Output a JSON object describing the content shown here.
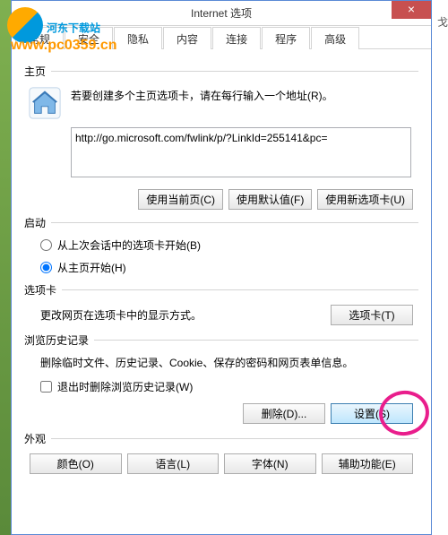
{
  "watermark": {
    "text1": "河东下载站",
    "text2": "www.pc0359.cn"
  },
  "titlebar": {
    "title": "Internet 选项",
    "close": "×"
  },
  "tabs": [
    {
      "label": "常规",
      "active": true
    },
    {
      "label": "安全",
      "active": false
    },
    {
      "label": "隐私",
      "active": false
    },
    {
      "label": "内容",
      "active": false
    },
    {
      "label": "连接",
      "active": false
    },
    {
      "label": "程序",
      "active": false
    },
    {
      "label": "高级",
      "active": false
    }
  ],
  "homepage": {
    "section_label": "主页",
    "instruction": "若要创建多个主页选项卡，请在每行输入一个地址(R)。",
    "url": "http://go.microsoft.com/fwlink/p/?LinkId=255141&pc=",
    "btn_current": "使用当前页(C)",
    "btn_default": "使用默认值(F)",
    "btn_newtab": "使用新选项卡(U)"
  },
  "startup": {
    "section_label": "启动",
    "option1": "从上次会话中的选项卡开始(B)",
    "option2": "从主页开始(H)"
  },
  "options_section": {
    "section_label": "选项卡",
    "text": "更改网页在选项卡中的显示方式。",
    "btn": "选项卡(T)"
  },
  "history": {
    "section_label": "浏览历史记录",
    "text": "删除临时文件、历史记录、Cookie、保存的密码和网页表单信息。",
    "checkbox": "退出时删除浏览历史记录(W)",
    "btn_delete": "删除(D)...",
    "btn_settings": "设置(S)"
  },
  "appearance": {
    "section_label": "外观",
    "btn_color": "颜色(O)",
    "btn_lang": "语言(L)",
    "btn_font": "字体(N)",
    "btn_access": "辅助功能(E)"
  },
  "right_edge_text": "戈"
}
